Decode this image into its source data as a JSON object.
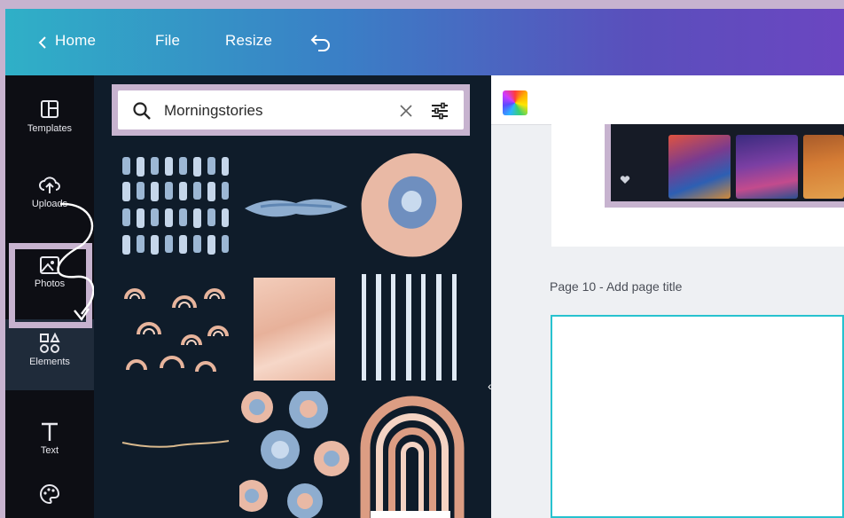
{
  "topbar": {
    "home_label": "Home",
    "file_label": "File",
    "resize_label": "Resize"
  },
  "rail": {
    "items": [
      {
        "label": "Templates",
        "icon": "templates-icon"
      },
      {
        "label": "Uploads",
        "icon": "upload-cloud-icon"
      },
      {
        "label": "Photos",
        "icon": "photos-icon"
      },
      {
        "label": "Elements",
        "icon": "elements-icon"
      },
      {
        "label": "Text",
        "icon": "text-icon"
      },
      {
        "label": "",
        "icon": "palette-icon"
      }
    ]
  },
  "search": {
    "value": "Morningstories"
  },
  "canvas": {
    "page_title": "Page 10 - Add page title"
  },
  "colors": {
    "accent_teal": "#27c2cf",
    "highlight_frame": "#c7b3cf",
    "panel_bg": "#0f1c2a"
  }
}
